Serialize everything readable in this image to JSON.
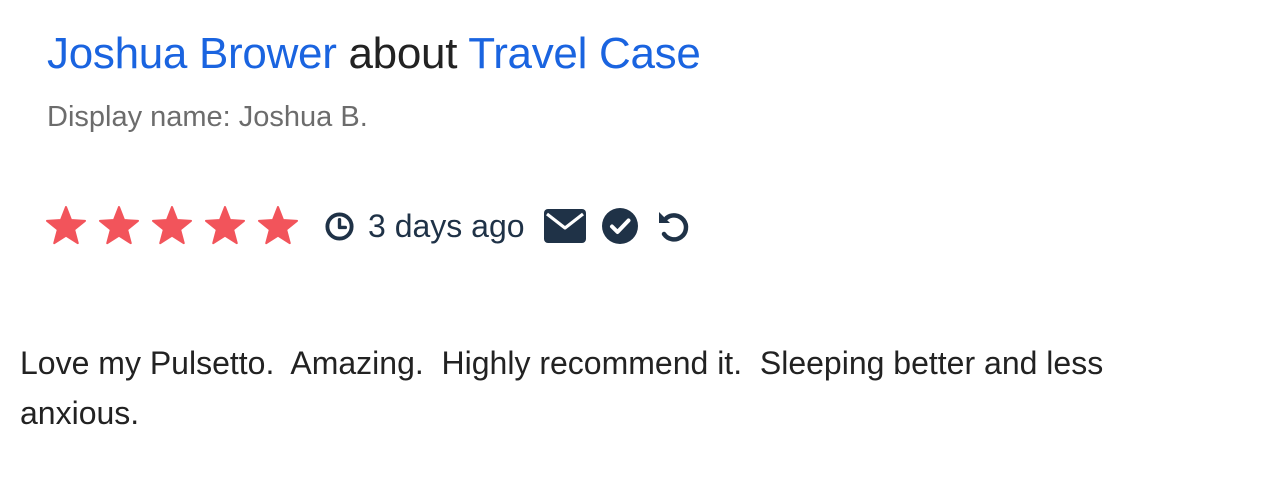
{
  "review": {
    "reviewer_name": "Joshua Brower",
    "connector": "about",
    "product_name": "Travel Case",
    "display_name": "Display name: Joshua B.",
    "rating": 5,
    "rating_max": 5,
    "time_ago": "3 days ago",
    "body": "Love my Pulsetto.  Amazing.  Highly recommend it.  Sleeping better and less anxious."
  },
  "icons": {
    "star": "star-icon",
    "clock": "clock-icon",
    "mail": "envelope-icon",
    "verified": "check-circle-icon",
    "undo": "undo-icon"
  },
  "colors": {
    "link": "#1a64e0",
    "star": "#f2545b",
    "meta": "#1f3247",
    "muted": "#6c6c6c",
    "text": "#222222"
  }
}
